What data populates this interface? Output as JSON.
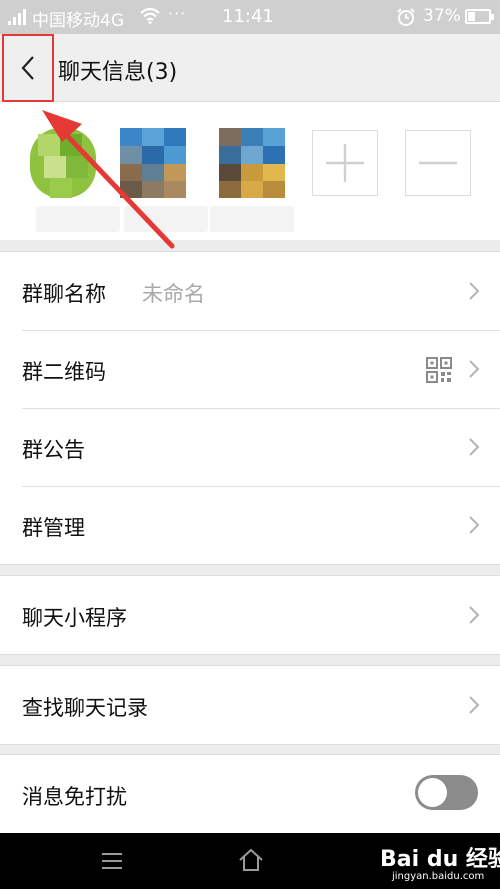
{
  "status_bar": {
    "carrier": "中国移动4G",
    "dots": "···",
    "time": "11:41",
    "battery": "37%",
    "battery_level": 0.37,
    "icons": [
      "signal-icon",
      "wifi-icon",
      "alarm-icon",
      "battery-icon"
    ]
  },
  "header": {
    "title": "聊天信息(3)",
    "back_icon": "chevron-left-icon"
  },
  "members": {
    "add_icon": "plus-icon",
    "remove_icon": "minus-icon"
  },
  "settings": {
    "group_name_label": "群聊名称",
    "group_name_value": "未命名",
    "qr_code_label": "群二维码",
    "announcement_label": "群公告",
    "management_label": "群管理",
    "mini_programs_label": "聊天小程序",
    "search_history_label": "查找聊天记录",
    "mute_label": "消息免打扰",
    "mute_enabled": false
  },
  "navbar": {
    "icons": [
      "menu-icon",
      "home-icon"
    ]
  },
  "watermark": {
    "main": "Bai du 经验",
    "sub": "jingyan.baidu.com"
  },
  "colors": {
    "annotation": "#e53935",
    "toggle_off": "#8c8c8c",
    "background": "#ececec"
  }
}
